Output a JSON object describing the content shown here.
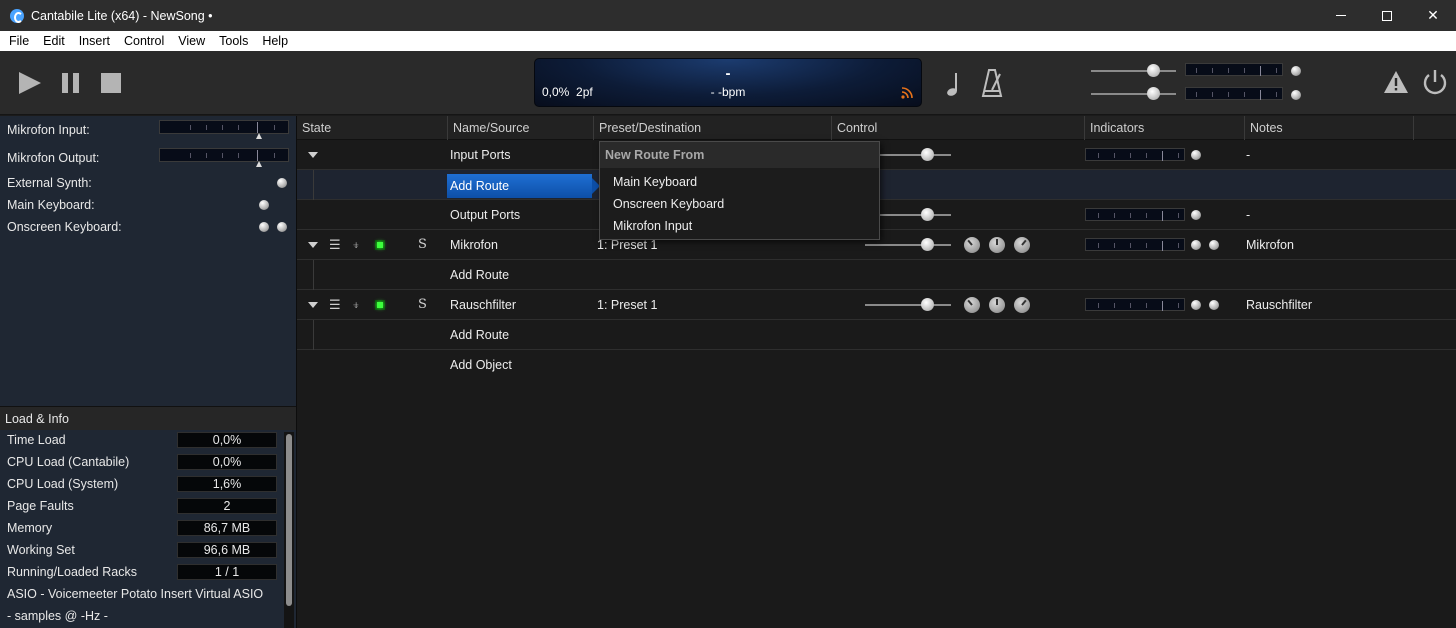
{
  "window": {
    "title": "Cantabile Lite (x64) - NewSong •",
    "controls": {
      "minimize": "minimize-icon",
      "maximize": "maximize-icon",
      "close": "✕"
    }
  },
  "menu": [
    "File",
    "Edit",
    "Insert",
    "Control",
    "View",
    "Tools",
    "Help"
  ],
  "toolbar": {
    "transport": [
      "play-icon",
      "pause-icon",
      "stop-icon"
    ],
    "lcd": {
      "song": "-",
      "load": "0,0%",
      "pf": "2pf",
      "bpm": "- -bpm"
    },
    "icons": [
      "note-icon",
      "metronome-icon",
      "warning-icon",
      "power-icon"
    ]
  },
  "ports": [
    {
      "label": "Mikrofon Input:"
    },
    {
      "label": "Mikrofon Output:"
    },
    {
      "label": "External Synth:"
    },
    {
      "label": "Main Keyboard:"
    },
    {
      "label": "Onscreen Keyboard:"
    }
  ],
  "load_info": {
    "title": "Load & Info",
    "rows": [
      {
        "label": "Time Load",
        "value": "0,0%"
      },
      {
        "label": "CPU Load (Cantabile)",
        "value": "0,0%"
      },
      {
        "label": "CPU Load (System)",
        "value": "1,6%"
      },
      {
        "label": "Page Faults",
        "value": "2"
      },
      {
        "label": "Memory",
        "value": "86,7 MB"
      },
      {
        "label": "Working Set",
        "value": "96,6 MB"
      },
      {
        "label": "Running/Loaded Racks",
        "value": "1 / 1"
      }
    ],
    "asio": "ASIO - Voicemeeter Potato Insert Virtual ASIO",
    "samples": "- samples @ -Hz -"
  },
  "table": {
    "headers": [
      "State",
      "Name/Source",
      "Preset/Destination",
      "Control",
      "Indicators",
      "Notes"
    ],
    "rows": {
      "input_ports": {
        "name": "Input Ports",
        "notes": "-"
      },
      "add_route_selected": {
        "name": "Add Route"
      },
      "output_ports": {
        "name": "Output Ports",
        "notes": "-"
      },
      "mikrofon": {
        "solo": "S",
        "name": "Mikrofon",
        "preset": "1: Preset 1",
        "notes": "Mikrofon"
      },
      "mikrofon_add_route": {
        "name": "Add Route"
      },
      "rauschfilter": {
        "solo": "S",
        "name": "Rauschfilter",
        "preset": "1: Preset 1",
        "notes": "Rauschfilter"
      },
      "rauschfilter_add_route": {
        "name": "Add Route"
      },
      "add_object": {
        "name": "Add Object"
      }
    }
  },
  "popup": {
    "title": "New Route From",
    "items": [
      "Main Keyboard",
      "Onscreen Keyboard",
      "Mikrofon Input"
    ]
  },
  "colors": {
    "selection": "#0d4fa8",
    "led_green": "#3cff3c",
    "lcd_bg": "#0d1c38"
  }
}
